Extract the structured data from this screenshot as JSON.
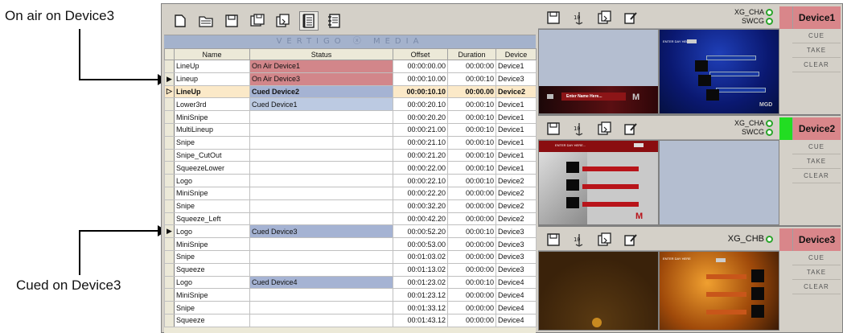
{
  "annotations": {
    "onair": "On air on Device3",
    "cued": "Cued on Device3"
  },
  "banner": "VERTIGO ⓧ MEDIA",
  "toolbar_icons": [
    "new-playlist-icon",
    "open-folder-icon",
    "save-icon",
    "save-as-icon",
    "copy-icon",
    "playlist-view-icon",
    "properties-icon"
  ],
  "columns": [
    "Name",
    "Status",
    "Offset",
    "Duration",
    "Device"
  ],
  "rows": [
    {
      "name": "LineUp",
      "status": "On Air Device1",
      "offset": "00:00:00.00",
      "duration": "00:00:00",
      "device": "Device1",
      "kind": "onair"
    },
    {
      "name": "Lineup",
      "status": "On Air Device3",
      "offset": "00:00:10.00",
      "duration": "00:00:10",
      "device": "Device3",
      "kind": "onair",
      "marker": "▶"
    },
    {
      "name": "LineUp",
      "status": "Cued Device2",
      "offset": "00:00:10.10",
      "duration": "00:00.00",
      "device": "Device2",
      "kind": "current",
      "marker": "▷"
    },
    {
      "name": "Lower3rd",
      "status": "Cued Device1",
      "offset": "00:00:20.10",
      "duration": "00:00:10",
      "device": "Device1",
      "kind": "cued1"
    },
    {
      "name": "MiniSnipe",
      "status": "",
      "offset": "00:00:20.20",
      "duration": "00:00:10",
      "device": "Device1",
      "kind": ""
    },
    {
      "name": "MultiLineup",
      "status": "",
      "offset": "00:00:21.00",
      "duration": "00:00:10",
      "device": "Device1",
      "kind": ""
    },
    {
      "name": "Snipe",
      "status": "",
      "offset": "00:00:21.10",
      "duration": "00:00:10",
      "device": "Device1",
      "kind": ""
    },
    {
      "name": "Snipe_CutOut",
      "status": "",
      "offset": "00:00:21.20",
      "duration": "00:00:10",
      "device": "Device1",
      "kind": ""
    },
    {
      "name": "SqueezeLower",
      "status": "",
      "offset": "00:00:22.00",
      "duration": "00:00:10",
      "device": "Device1",
      "kind": ""
    },
    {
      "name": "Logo",
      "status": "",
      "offset": "00:00:22.10",
      "duration": "00:00:10",
      "device": "Device2",
      "kind": ""
    },
    {
      "name": "MiniSnipe",
      "status": "",
      "offset": "00:00:22.20",
      "duration": "00:00:00",
      "device": "Device2",
      "kind": ""
    },
    {
      "name": "Snipe",
      "status": "",
      "offset": "00:00:32.20",
      "duration": "00:00:00",
      "device": "Device2",
      "kind": ""
    },
    {
      "name": "Squeeze_Left",
      "status": "",
      "offset": "00:00:42.20",
      "duration": "00:00:00",
      "device": "Device2",
      "kind": ""
    },
    {
      "name": "Logo",
      "status": "Cued Device3",
      "offset": "00:00:52.20",
      "duration": "00:00:10",
      "device": "Device3",
      "kind": "cued",
      "marker": "▶"
    },
    {
      "name": "MiniSnipe",
      "status": "",
      "offset": "00:00:53.00",
      "duration": "00:00:00",
      "device": "Device3",
      "kind": ""
    },
    {
      "name": "Snipe",
      "status": "",
      "offset": "00:01:03.02",
      "duration": "00:00:00",
      "device": "Device3",
      "kind": ""
    },
    {
      "name": "Squeeze",
      "status": "",
      "offset": "00:01:13.02",
      "duration": "00:00:00",
      "device": "Device3",
      "kind": ""
    },
    {
      "name": "Logo",
      "status": "Cued Device4",
      "offset": "00:01:23.02",
      "duration": "00:00:10",
      "device": "Device4",
      "kind": "cued"
    },
    {
      "name": "MiniSnipe",
      "status": "",
      "offset": "00:01:23.12",
      "duration": "00:00:00",
      "device": "Device4",
      "kind": ""
    },
    {
      "name": "Snipe",
      "status": "",
      "offset": "00:01:33.12",
      "duration": "00:00:00",
      "device": "Device4",
      "kind": ""
    },
    {
      "name": "Squeeze",
      "status": "",
      "offset": "00:01:43.12",
      "duration": "00:00:00",
      "device": "Device4",
      "kind": ""
    }
  ],
  "devices": [
    {
      "name": "Device1",
      "tally_a": "XG_CHA",
      "tally_b": "SWCG",
      "status_color": "#d9868a",
      "buttons": [
        "CUE",
        "TAKE",
        "CLEAR"
      ]
    },
    {
      "name": "Device2",
      "tally_a": "XG_CHA",
      "tally_b": "SWCG",
      "status_color": "#22dd22",
      "buttons": [
        "CUE",
        "TAKE",
        "CLEAR"
      ]
    },
    {
      "name": "Device3",
      "tally_a": "XG_CHB",
      "tally_b": "",
      "status_color": "#d9868a",
      "buttons": [
        "CUE",
        "TAKE",
        "CLEAR"
      ]
    }
  ],
  "graphics_text": {
    "enter_day": "ENTER DAY HERE...",
    "enter_day_short": "ENTER DAY HERE",
    "enter_name": "Enter Name Here...",
    "logo": "M",
    "logo_small": "MGD"
  },
  "colors": {
    "onair": "#d2868a",
    "cued": "#a5b3d3",
    "current_row": "#fbe9c8",
    "tally_led": "#2aa52a"
  }
}
